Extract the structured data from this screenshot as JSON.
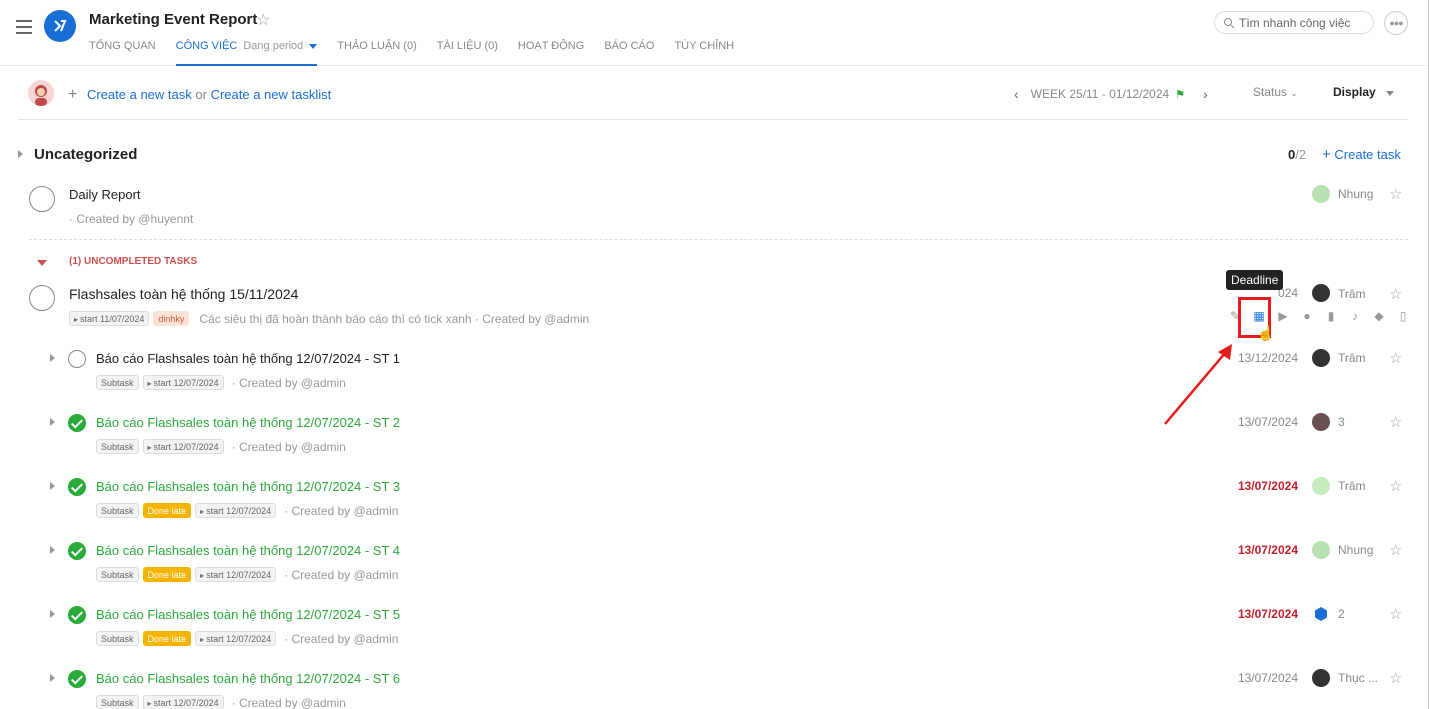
{
  "header": {
    "title": "Marketing Event Report",
    "search_placeholder": "Tìm nhanh công việc",
    "tabs": [
      {
        "label": "TỔNG QUAN"
      },
      {
        "label": "CÔNG VIỆC",
        "sub": "Dạng period"
      },
      {
        "label": "THẢO LUẬN (0)"
      },
      {
        "label": "TÀI LIỆU (0)"
      },
      {
        "label": "HOẠT ĐỘNG"
      },
      {
        "label": "BÁO CÁO"
      },
      {
        "label": "TÙY CHỈNH"
      }
    ]
  },
  "toolbar": {
    "create_task": "Create a new task",
    "or": "or",
    "create_tasklist": "Create a new tasklist",
    "week": "WEEK 25/11 - 01/12/2024",
    "status": "Status",
    "display": "Display"
  },
  "section": {
    "title": "Uncategorized",
    "done": "0",
    "total": "/2",
    "create_task": "Create task"
  },
  "task1": {
    "title": "Daily Report",
    "meta": "· Created by @huyennt",
    "assignee": "Nhung"
  },
  "group": {
    "label": "(1) UNCOMPLETED TASKS"
  },
  "task2": {
    "title": "Flashsales toàn hệ thống 15/11/2024",
    "start": "start 11/07/2024",
    "tag": "dinhky",
    "meta": "Các siêu thị đã hoàn thành báo cáo thì có tick xanh · Created by @admin",
    "date_suffix": "024",
    "assignee": "Trâm",
    "tooltip": "Deadline"
  },
  "subtasks": [
    {
      "title": "Báo cáo Flashsales toàn hệ thống 12/07/2024 - ST 1",
      "chip": "Subtask",
      "late": "",
      "start": "start 12/07/2024",
      "meta": "· Created by @admin",
      "date": "13/12/2024",
      "assignee": "Trâm"
    },
    {
      "title": "Báo cáo Flashsales toàn hệ thống 12/07/2024 - ST 2",
      "chip": "Subtask",
      "late": "",
      "start": "start 12/07/2024",
      "meta": "· Created by @admin",
      "date": "13/07/2024",
      "assignee": "3"
    },
    {
      "title": "Báo cáo Flashsales toàn hệ thống 12/07/2024 - ST 3",
      "chip": "Subtask",
      "late": "Done late",
      "start": "start 12/07/2024",
      "meta": "· Created by @admin",
      "date": "13/07/2024",
      "assignee": "Trâm"
    },
    {
      "title": "Báo cáo Flashsales toàn hệ thống 12/07/2024 - ST 4",
      "chip": "Subtask",
      "late": "Done late",
      "start": "start 12/07/2024",
      "meta": "· Created by @admin",
      "date": "13/07/2024",
      "assignee": "Nhung"
    },
    {
      "title": "Báo cáo Flashsales toàn hệ thống 12/07/2024 - ST 5",
      "chip": "Subtask",
      "late": "Done late",
      "start": "start 12/07/2024",
      "meta": "· Created by @admin",
      "date": "13/07/2024",
      "assignee": "2"
    },
    {
      "title": "Báo cáo Flashsales toàn hệ thống 12/07/2024 - ST 6",
      "chip": "Subtask",
      "late": "",
      "start": "start 12/07/2024",
      "meta": "· Created by @admin",
      "date": "13/07/2024",
      "assignee": "Thục ..."
    }
  ],
  "colors": {
    "accent": "#1a6fd6",
    "done": "#2aaa3a",
    "late": "#f5b400",
    "overdue": "#c0202a",
    "highlight": "#e51b1b"
  }
}
